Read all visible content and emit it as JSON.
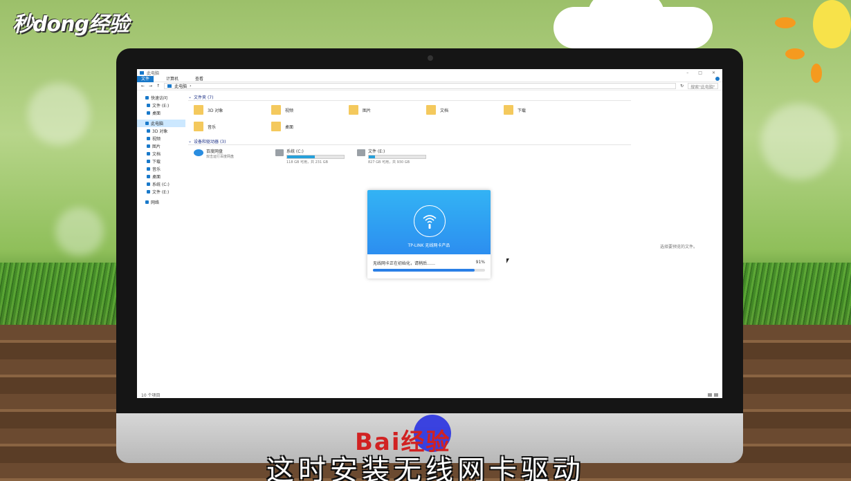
{
  "watermark": {
    "logo": "秒dong经验"
  },
  "explorer": {
    "window_title": "此电脑",
    "ribbon_tabs": [
      "文件",
      "计算机",
      "查看"
    ],
    "address_path": "此电脑",
    "search_placeholder": "搜索\"此电脑\"",
    "nav": {
      "quick_access": "快速访问",
      "quick_items": [
        "文件 (E:)",
        "桌面"
      ],
      "this_pc": "此电脑",
      "pc_items": [
        "3D 对象",
        "视频",
        "图片",
        "文档",
        "下载",
        "音乐",
        "桌面",
        "系统 (C:)",
        "文件 (E:)"
      ],
      "network": "网络"
    },
    "folders_section": "文件夹 (7)",
    "folders": [
      "3D 对象",
      "视频",
      "图片",
      "文档",
      "下载",
      "音乐",
      "桌面"
    ],
    "devices_section": "设备和驱动器 (3)",
    "devices": [
      {
        "name": "百度网盘",
        "detail": "双击运行百度网盘",
        "fill": null
      },
      {
        "name": "系统 (C:)",
        "detail": "118 GB 可用，共 231 GB",
        "fill": 0.49
      },
      {
        "name": "文件 (E:)",
        "detail": "827 GB 可用，共 930 GB",
        "fill": 0.11
      }
    ],
    "preview_hint": "选择要预览的文件。",
    "status_count": "10 个项目"
  },
  "installer": {
    "product": "TP-LINK 无线网卡产品",
    "status": "无线网卡正在初始化，请稍后……",
    "percent_label": "91%",
    "progress": 0.91
  },
  "chin_brand": "Bai经验",
  "subtitle": "这时安装无线网卡驱动",
  "colors": {
    "accent": "#1979ca",
    "progress": "#2a7fe6",
    "dialog_top": "#2c8ef0"
  }
}
